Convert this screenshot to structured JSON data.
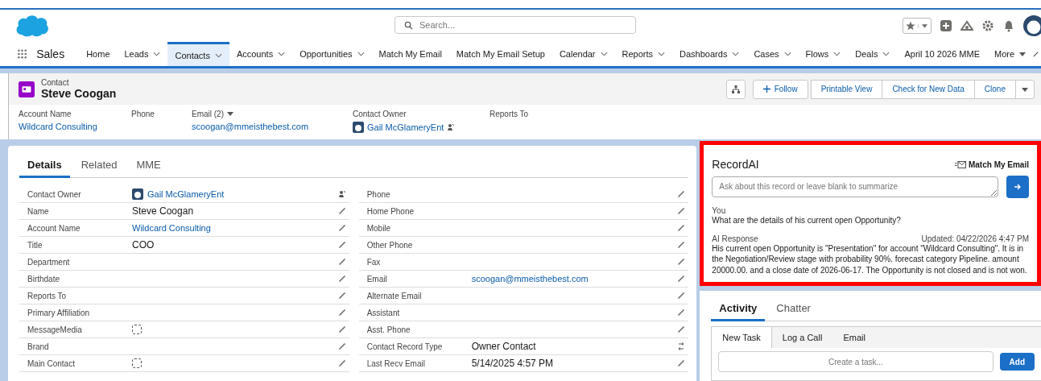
{
  "header": {
    "search_placeholder": "Search..."
  },
  "nav": {
    "app_name": "Sales",
    "items": [
      {
        "label": "Home",
        "selected": false,
        "dropdown": false
      },
      {
        "label": "Leads",
        "selected": false,
        "dropdown": true
      },
      {
        "label": "Contacts",
        "selected": true,
        "dropdown": true
      },
      {
        "label": "Accounts",
        "selected": false,
        "dropdown": true
      },
      {
        "label": "Opportunities",
        "selected": false,
        "dropdown": true
      },
      {
        "label": "Match My Email",
        "selected": false,
        "dropdown": false
      },
      {
        "label": "Match My Email Setup",
        "selected": false,
        "dropdown": false
      },
      {
        "label": "Calendar",
        "selected": false,
        "dropdown": true
      },
      {
        "label": "Reports",
        "selected": false,
        "dropdown": true
      },
      {
        "label": "Dashboards",
        "selected": false,
        "dropdown": true
      },
      {
        "label": "Cases",
        "selected": false,
        "dropdown": true
      },
      {
        "label": "Flows",
        "selected": false,
        "dropdown": true
      },
      {
        "label": "Deals",
        "selected": false,
        "dropdown": true
      },
      {
        "label": "April 10 2026 MME",
        "selected": false,
        "dropdown": false
      }
    ],
    "more": "More"
  },
  "record": {
    "type": "Contact",
    "name": "Steve Coogan",
    "actions": [
      "Follow",
      "Printable View",
      "Check for New Data",
      "Clone"
    ]
  },
  "highlights": [
    {
      "label": "Account Name",
      "value": "Wildcard Consulting",
      "kind": "link"
    },
    {
      "label": "Phone",
      "kind": "text"
    },
    {
      "label": "Email (2)",
      "value": "scoogan@mmeisthebest.com",
      "kind": "email"
    },
    {
      "label": "Contact Owner",
      "value": "Gail McGlameryEnt",
      "kind": "owner"
    },
    {
      "label": "Reports To",
      "kind": "text"
    }
  ],
  "detail_tabs": [
    {
      "label": "Details",
      "selected": true
    },
    {
      "label": "Related",
      "selected": false
    },
    {
      "label": "MME",
      "selected": false
    }
  ],
  "fields_left": [
    {
      "label": "Contact Owner",
      "value": "Gail McGlameryEnt",
      "kind": "owner"
    },
    {
      "label": "Name",
      "value": "Steve Coogan",
      "kind": "text"
    },
    {
      "label": "Account Name",
      "value": "Wildcard Consulting",
      "kind": "link"
    },
    {
      "label": "Title",
      "value": "COO",
      "kind": "text"
    },
    {
      "label": "Department",
      "kind": "text"
    },
    {
      "label": "Birthdate",
      "kind": "text"
    },
    {
      "label": "Reports To",
      "kind": "text"
    },
    {
      "label": "Primary Affiliation",
      "kind": "text"
    },
    {
      "label": "MessageMedia",
      "kind": "checkbox",
      "checked": false
    },
    {
      "label": "Brand",
      "kind": "text"
    },
    {
      "label": "Main Contact",
      "kind": "checkbox",
      "checked": false
    }
  ],
  "fields_right": [
    {
      "label": "Phone",
      "kind": "text"
    },
    {
      "label": "Home Phone",
      "kind": "text"
    },
    {
      "label": "Mobile",
      "kind": "text"
    },
    {
      "label": "Other Phone",
      "kind": "text"
    },
    {
      "label": "Fax",
      "kind": "text"
    },
    {
      "label": "Email",
      "value": "scoogan@mmeisthebest.com",
      "kind": "link"
    },
    {
      "label": "Alternate Email",
      "kind": "text"
    },
    {
      "label": "Assistant",
      "kind": "text"
    },
    {
      "label": "Asst. Phone",
      "kind": "text"
    },
    {
      "label": "Contact Record Type",
      "value": "Owner Contact",
      "kind": "record_type"
    },
    {
      "label": "Last Recv Email",
      "value": "5/14/2025 4:57 PM",
      "kind": "text"
    }
  ],
  "record_ai": {
    "title": "RecordAI",
    "brand": "Match My Email",
    "placeholder": "Ask about this record or leave blank to summarize",
    "you_label": "You",
    "question": "What are the details of his current open Opportunity?",
    "response_label": "AI Response",
    "updated": "Updated: 04/22/2026 4:47 PM",
    "response": "His current open Opportunity is \"Presentation\" for account \"Wildcard Consulting\". It is in the Negotiation/Review stage with probability 90%. forecast category Pipeline. amount 20000.00. and a close date of 2026-06-17. The Opportunity is not closed and is not won."
  },
  "activity": {
    "tabs": [
      {
        "label": "Activity",
        "selected": true
      },
      {
        "label": "Chatter",
        "selected": false
      }
    ],
    "subtabs": [
      {
        "label": "New Task",
        "selected": true
      },
      {
        "label": "Log a Call",
        "selected": false
      },
      {
        "label": "Email",
        "selected": false
      }
    ],
    "task_placeholder": "Create a task...",
    "add_button": "Add"
  }
}
